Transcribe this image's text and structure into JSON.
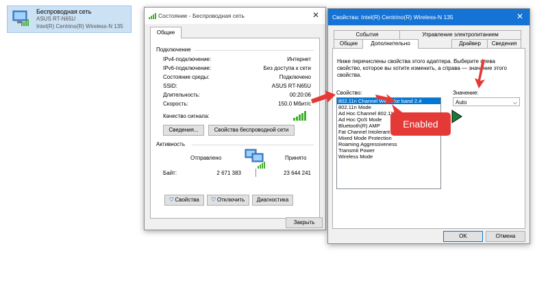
{
  "network_tile": {
    "name": "Беспроводная сеть",
    "ssid": "ASUS RT-N65U",
    "adapter": "Intel(R) Centrino(R) Wireless-N 135"
  },
  "status_window": {
    "title": "Состояние - Беспроводная сеть",
    "tab": "Общие",
    "connection_header": "Подключение",
    "rows": [
      {
        "label": "IPv4-подключение:",
        "value": "Интернет"
      },
      {
        "label": "IPv6-подключение:",
        "value": "Без доступа к сети"
      },
      {
        "label": "Состояние среды:",
        "value": "Подключено"
      },
      {
        "label": "SSID:",
        "value": "ASUS RT-N65U"
      },
      {
        "label": "Длительность:",
        "value": "00:20:06"
      },
      {
        "label": "Скорость:",
        "value": "150.0 Мбит/с"
      }
    ],
    "signal_label": "Качество сигнала:",
    "signal_bars": 5,
    "details_button": "Сведения...",
    "wireless_props_button": "Свойства беспроводной сети",
    "activity_header": "Активность",
    "sent_label": "Отправлено",
    "received_label": "Принято",
    "bytes_label": "Байт:",
    "bytes_sent": "2 671 383",
    "bytes_received": "23 644 241",
    "properties_button": "Свойства",
    "disable_button": "Отключить",
    "diagnose_button": "Диагностика",
    "close_button": "Закрыть"
  },
  "props_window": {
    "title": "Свойства: Intel(R) Centrino(R) Wireless-N 135",
    "tabs_top": [
      "События",
      "Управление электропитанием"
    ],
    "tabs_bottom": [
      "Общие",
      "Дополнительно",
      "Драйвер",
      "Сведения"
    ],
    "active_tab": "Дополнительно",
    "description": "Ниже перечислены свойства этого адаптера. Выберите слева свойство, которое вы хотите изменить, а справа — значение этого свойства.",
    "property_label": "Свойство:",
    "value_label": "Значение:",
    "properties": [
      "802.11n Channel Width for band 2.4",
      "802.11n Mode",
      "Ad Hoc Channel 802.11b/g",
      "Ad Hoc QoS Mode",
      "Bluetooth(R) AMP",
      "Fat Channel Intolerant",
      "Mixed Mode Protection",
      "Roaming Aggressiveness",
      "Transmit Power",
      "Wireless Mode"
    ],
    "selected_index": 0,
    "value": "Auto",
    "ok_button": "OK",
    "cancel_button": "Отмена"
  },
  "annotation": {
    "bubble_text": "Enabled",
    "color": "#e43a37"
  },
  "colors": {
    "accent": "#0078d7",
    "titlebar_active": "#1573d6",
    "signal": "#3fae2a"
  }
}
